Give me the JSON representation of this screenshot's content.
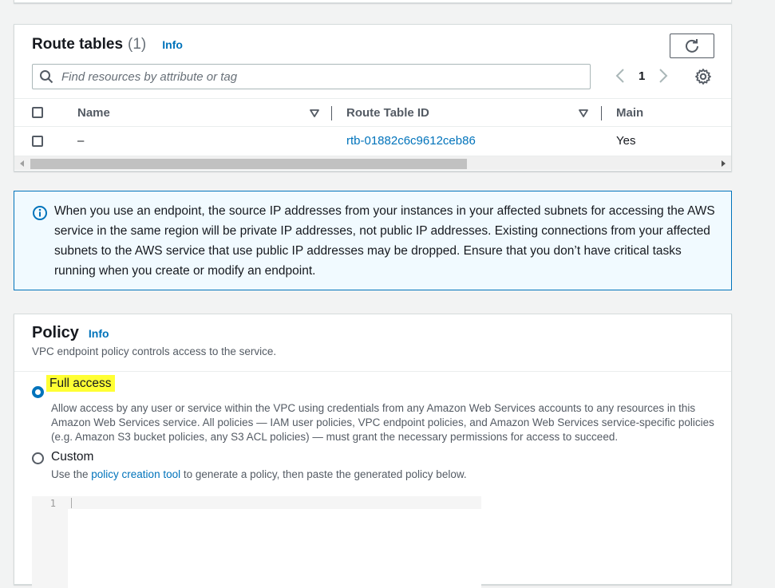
{
  "route_tables": {
    "title": "Route tables",
    "count": "(1)",
    "info": "Info",
    "search_placeholder": "Find resources by attribute or tag",
    "page": "1",
    "columns": [
      "Name",
      "Route Table ID",
      "Main"
    ],
    "rows": [
      {
        "name": "–",
        "route_table_id": "rtb-01882c6c9612ceb86",
        "main": "Yes"
      }
    ]
  },
  "info_alert": {
    "text": "When you use an endpoint, the source IP addresses from your instances in your affected subnets for accessing the AWS service in the same region will be private IP addresses, not public IP addresses. Existing connections from your affected subnets to the AWS service that use public IP addresses may be dropped. Ensure that you don’t have critical tasks running when you create or modify an endpoint."
  },
  "policy": {
    "title": "Policy",
    "info": "Info",
    "description": "VPC endpoint policy controls access to the service.",
    "options": [
      {
        "label": "Full access",
        "selected": true,
        "description": "Allow access by any user or service within the VPC using credentials from any Amazon Web Services accounts to any resources in this Amazon Web Services service. All policies — IAM user policies, VPC endpoint policies, and Amazon Web Services service-specific policies (e.g. Amazon S3 bucket policies, any S3 ACL policies) — must grant the necessary permissions for access to succeed."
      },
      {
        "label": "Custom",
        "selected": false,
        "description_prefix": "Use the ",
        "description_link": "policy creation tool",
        "description_suffix": " to generate a policy, then paste the generated policy below."
      }
    ],
    "editor_line_number": "1"
  },
  "colors": {
    "accent": "#0073bb",
    "highlight": "#ffff33",
    "alert_bg": "#f1faff"
  }
}
